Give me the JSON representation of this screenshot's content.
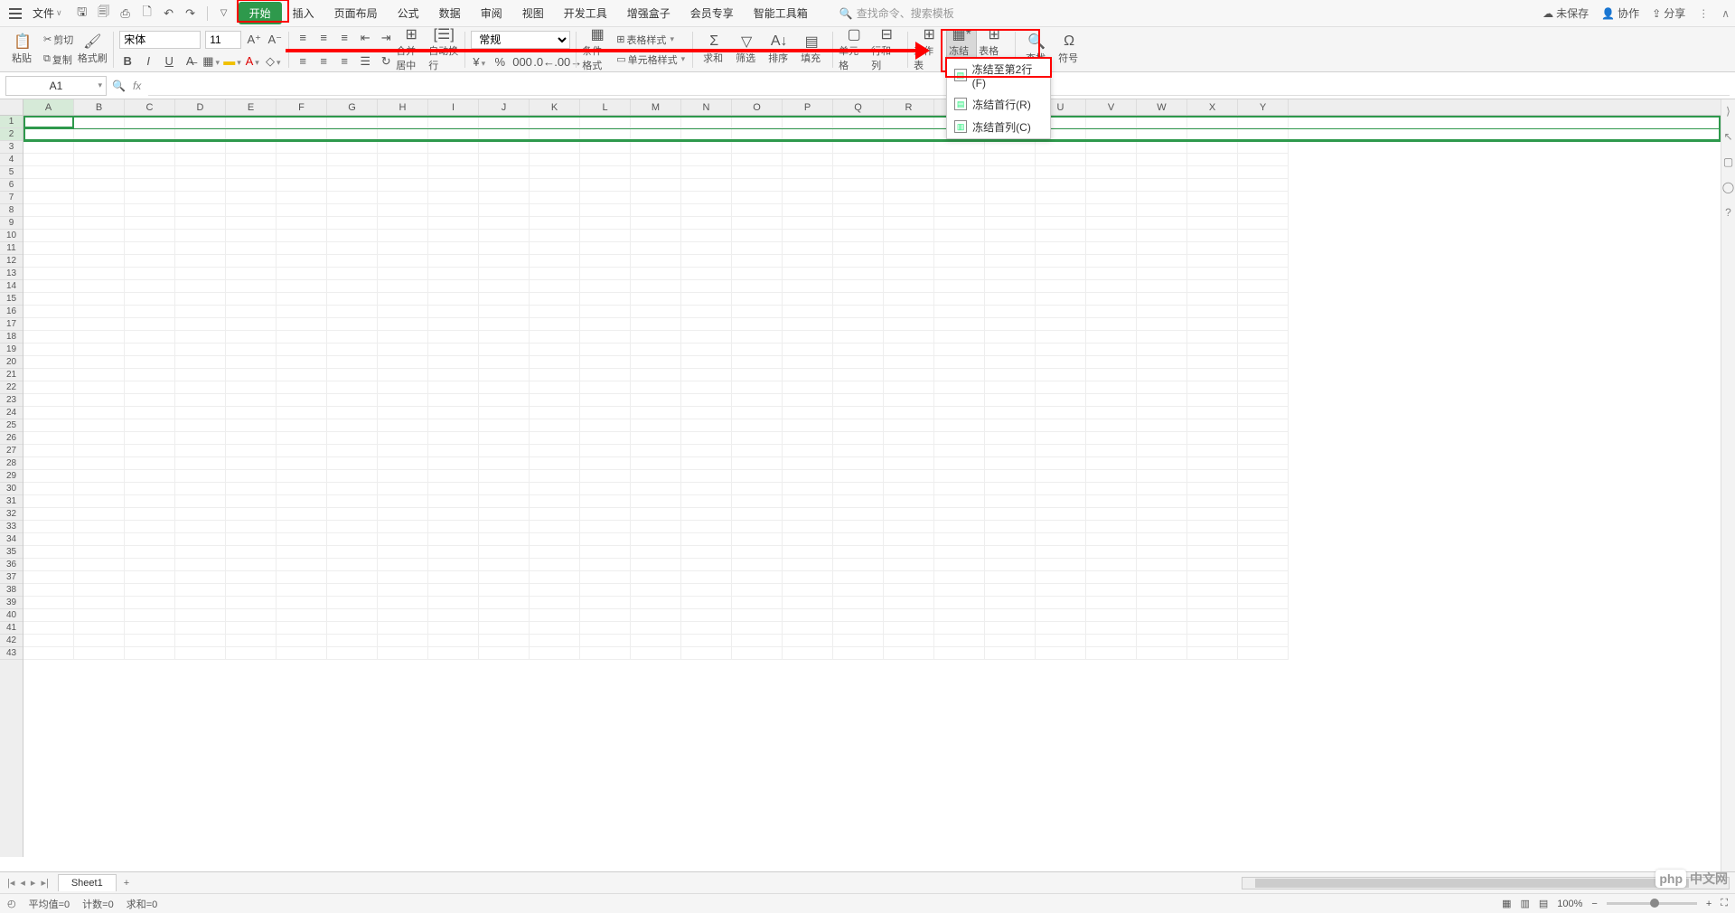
{
  "menu": {
    "file": "文件",
    "tabs": [
      "开始",
      "插入",
      "页面布局",
      "公式",
      "数据",
      "审阅",
      "视图",
      "开发工具",
      "增强盒子",
      "会员专享",
      "智能工具箱"
    ],
    "search_placeholder": "查找命令、搜索模板",
    "right": {
      "unsaved": "未保存",
      "collab": "协作",
      "share": "分享"
    }
  },
  "ribbon": {
    "paste": "粘贴",
    "cut": "剪切",
    "copy": "复制",
    "format_painter": "格式刷",
    "font_name": "宋体",
    "font_size": "11",
    "merge": "合并居中",
    "wrap": "自动换行",
    "number_fmt": "常规",
    "cond_fmt": "条件格式",
    "cell_style": "单元格样式",
    "sum": "求和",
    "filter": "筛选",
    "sort": "排序",
    "fill": "填充",
    "cell": "单元格",
    "row_col": "行和列",
    "worksheet": "工作表",
    "freeze": "冻结窗格",
    "table_tools": "表格工具",
    "find": "查找",
    "symbol": "符号",
    "table_style": "表格样式"
  },
  "freeze_menu": {
    "to_row": "冻结至第2行(F)",
    "first_row": "冻结首行(R)",
    "first_col": "冻结首列(C)"
  },
  "formula": {
    "cell_ref": "A1",
    "fx": "fx"
  },
  "grid": {
    "cols": [
      "A",
      "B",
      "C",
      "D",
      "E",
      "F",
      "G",
      "H",
      "I",
      "J",
      "K",
      "L",
      "M",
      "N",
      "O",
      "P",
      "Q",
      "R",
      "S",
      "T",
      "U",
      "V",
      "W",
      "X",
      "Y"
    ],
    "max_rows": 43
  },
  "sheet_tabs": {
    "name": "Sheet1"
  },
  "status": {
    "ready_icon": "⤷",
    "avg": "平均值=0",
    "count": "计数=0",
    "sum": "求和=0",
    "zoom": "100%"
  },
  "watermark": {
    "brand": "php",
    "cn": "中文网"
  }
}
